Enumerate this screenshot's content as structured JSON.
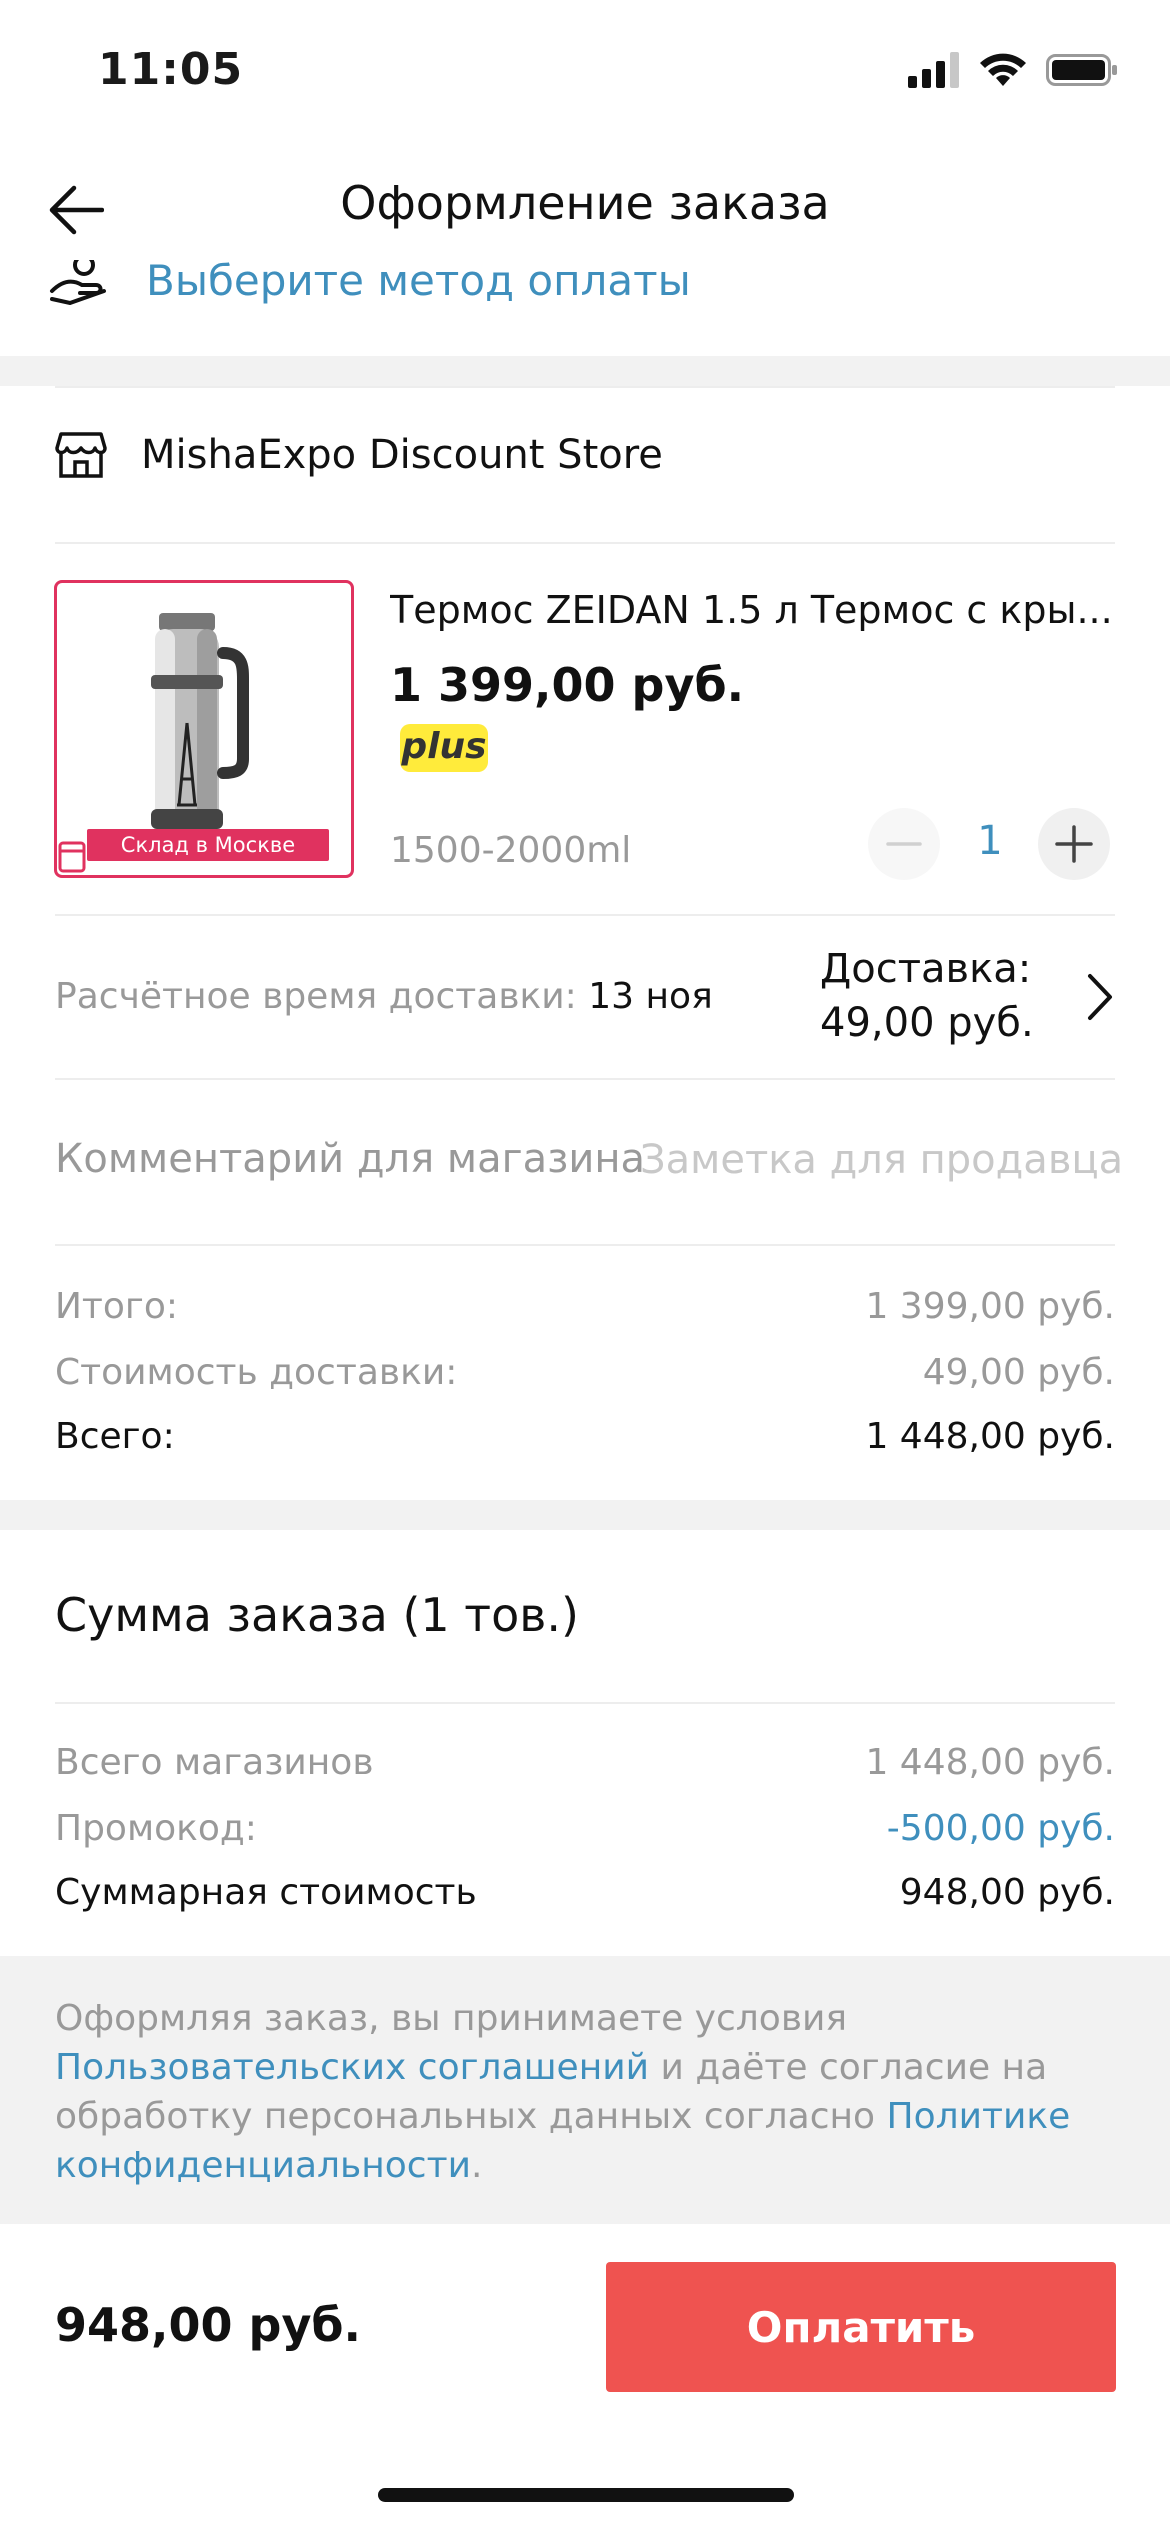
{
  "status_bar": {
    "time": "11:05"
  },
  "nav": {
    "title": "Оформление заказа"
  },
  "payment": {
    "label": "Выберите метод оплаты"
  },
  "store": {
    "name": "MishaExpo Discount Store"
  },
  "product": {
    "title": "Термос ZEIDAN 1.5 л Термос с кры...",
    "price": "1 399,00 руб.",
    "badge": "plus",
    "warehouse_badge": "Склад в Москве",
    "variant": "1500-2000ml",
    "quantity": "1"
  },
  "delivery": {
    "eta_label": "Расчётное время доставки:",
    "eta_value": "13 ноя",
    "shipping_line1": "Доставка:",
    "shipping_line2": "49,00 руб."
  },
  "comment": {
    "label": "Комментарий для магазина",
    "placeholder": "Заметка для продавца"
  },
  "store_summary": [
    {
      "label": "Итого:",
      "value": "1 399,00 руб."
    },
    {
      "label": "Стоимость доставки:",
      "value": "49,00 руб."
    },
    {
      "label": "Всего:",
      "value": "1 448,00 руб."
    }
  ],
  "order_summary": {
    "title": "Сумма заказа (1 тов.)",
    "rows": [
      {
        "label": "Всего магазинов",
        "value": "1 448,00 руб."
      },
      {
        "label": "Промокод:",
        "value": "-500,00 руб."
      },
      {
        "label": "Суммарная стоимость",
        "value": "948,00 руб."
      }
    ]
  },
  "legal": {
    "text1": "Оформляя заказ, вы принимаете условия ",
    "link1": "Пользовательских соглашений",
    "text2": " и даёте согласие на обработку персональных данных согласно ",
    "link2": "Политике конфиденциальности",
    "text3": "."
  },
  "footer": {
    "total": "948,00 руб.",
    "pay_label": "Оплатить"
  },
  "colors": {
    "accent_blue": "#3f8fbd",
    "pay_button": "#ef5350",
    "warehouse_pink": "#e0325f",
    "plus_yellow": "#ffeb3b"
  }
}
